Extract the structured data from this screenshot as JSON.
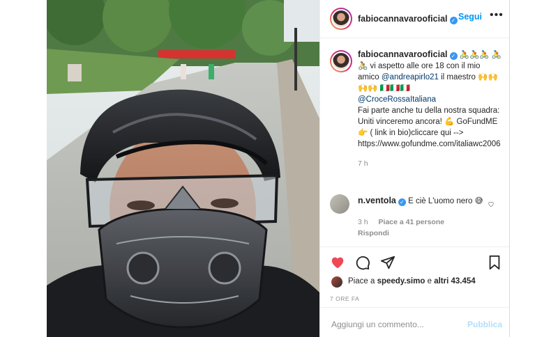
{
  "post": {
    "username": "fabiocannavarooficial",
    "follow_label": "Segui",
    "more_label": "•••"
  },
  "caption": {
    "username": "fabiocannavarooficial",
    "emoji_bikes": "🚴🚴🚴",
    "line1": "🚴🚴 vi aspetto alle ore 18 con il mio amico ",
    "mention_1": "@andreapirlo21",
    "line2": " il maestro 🙌🙌🙌🙌 🇮🇹🇮🇹🇮🇹",
    "mention_2": "@CroceRossaItaliana",
    "body": "Fai parte anche tu della nostra squadra: Uniti vinceremo ancora! 💪 GoFundME 👉 ( link in bio)cliccare qui -->",
    "link": "https://www.gofundme.com/italiawc2006",
    "time": "7 h"
  },
  "comment": {
    "username": "n.ventola",
    "text": "E ciè L'uomo nero 😅",
    "time": "3 h",
    "likes": "Piace a 41 persone",
    "reply": "Rispondi"
  },
  "likes": {
    "prefix": "Piace a ",
    "user": "speedy.simo",
    "middle": " e ",
    "others": "altri 43.454"
  },
  "timestamp": "7 ORE FA",
  "add_comment": {
    "placeholder": "Aggiungi un commento...",
    "publish": "Pubblica"
  },
  "colors": {
    "accent": "#0095f6",
    "like": "#ed4956",
    "publish_disabled": "#b2dffc"
  },
  "icons": [
    "heart-icon",
    "comment-icon",
    "share-icon",
    "bookmark-icon",
    "verified-icon",
    "more-icon"
  ]
}
